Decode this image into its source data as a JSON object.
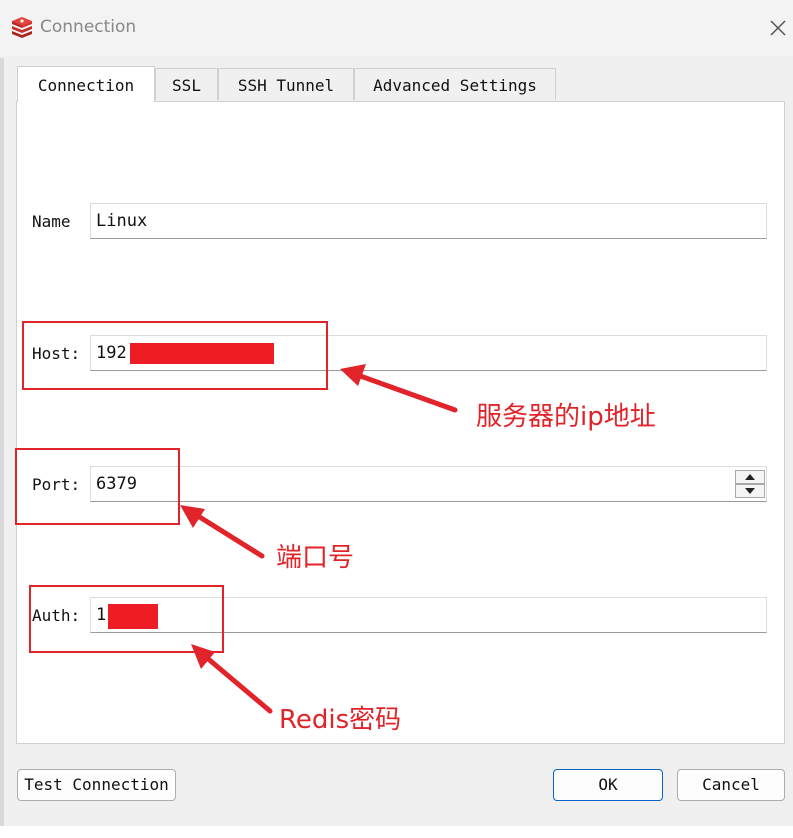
{
  "window": {
    "title": "Connection",
    "app_icon": "redis-logo-icon",
    "close_icon": "close-icon"
  },
  "tabs": [
    {
      "label": "Connection",
      "active": true
    },
    {
      "label": "SSL",
      "active": false
    },
    {
      "label": "SSH Tunnel",
      "active": false
    },
    {
      "label": "Advanced Settings",
      "active": false
    }
  ],
  "form": {
    "name": {
      "label": "Name",
      "value": "Linux"
    },
    "host": {
      "label": "Host:",
      "value": "192."
    },
    "port": {
      "label": "Port:",
      "value": "6379"
    },
    "auth": {
      "label": "Auth:",
      "value": "1"
    }
  },
  "annotations": {
    "host_note": "服务器的ip地址",
    "port_note": "端口号",
    "auth_note": "Redis密码",
    "color": "#e0242a",
    "redaction_color": "#ee1c25"
  },
  "buttons": {
    "test": "Test Connection",
    "ok": "OK",
    "cancel": "Cancel"
  },
  "colors": {
    "accent": "#0a63c8",
    "window_bg": "#f0f0f0"
  }
}
